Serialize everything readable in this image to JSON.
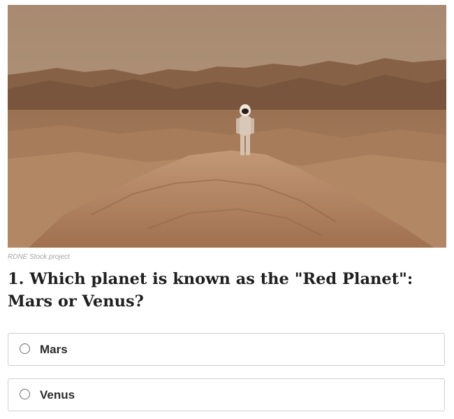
{
  "image": {
    "alt_icon": "astronaut-desert-photo",
    "credit": "RDNE Stock project"
  },
  "question": {
    "text": "1. Which planet is known as the \"Red Planet\": Mars or Venus?"
  },
  "options": [
    {
      "label": "Mars",
      "selected": false
    },
    {
      "label": "Venus",
      "selected": false
    }
  ],
  "colors": {
    "sky": "#ac8b6d",
    "terrain": "#a57a55",
    "border": "#cfcfcf"
  }
}
